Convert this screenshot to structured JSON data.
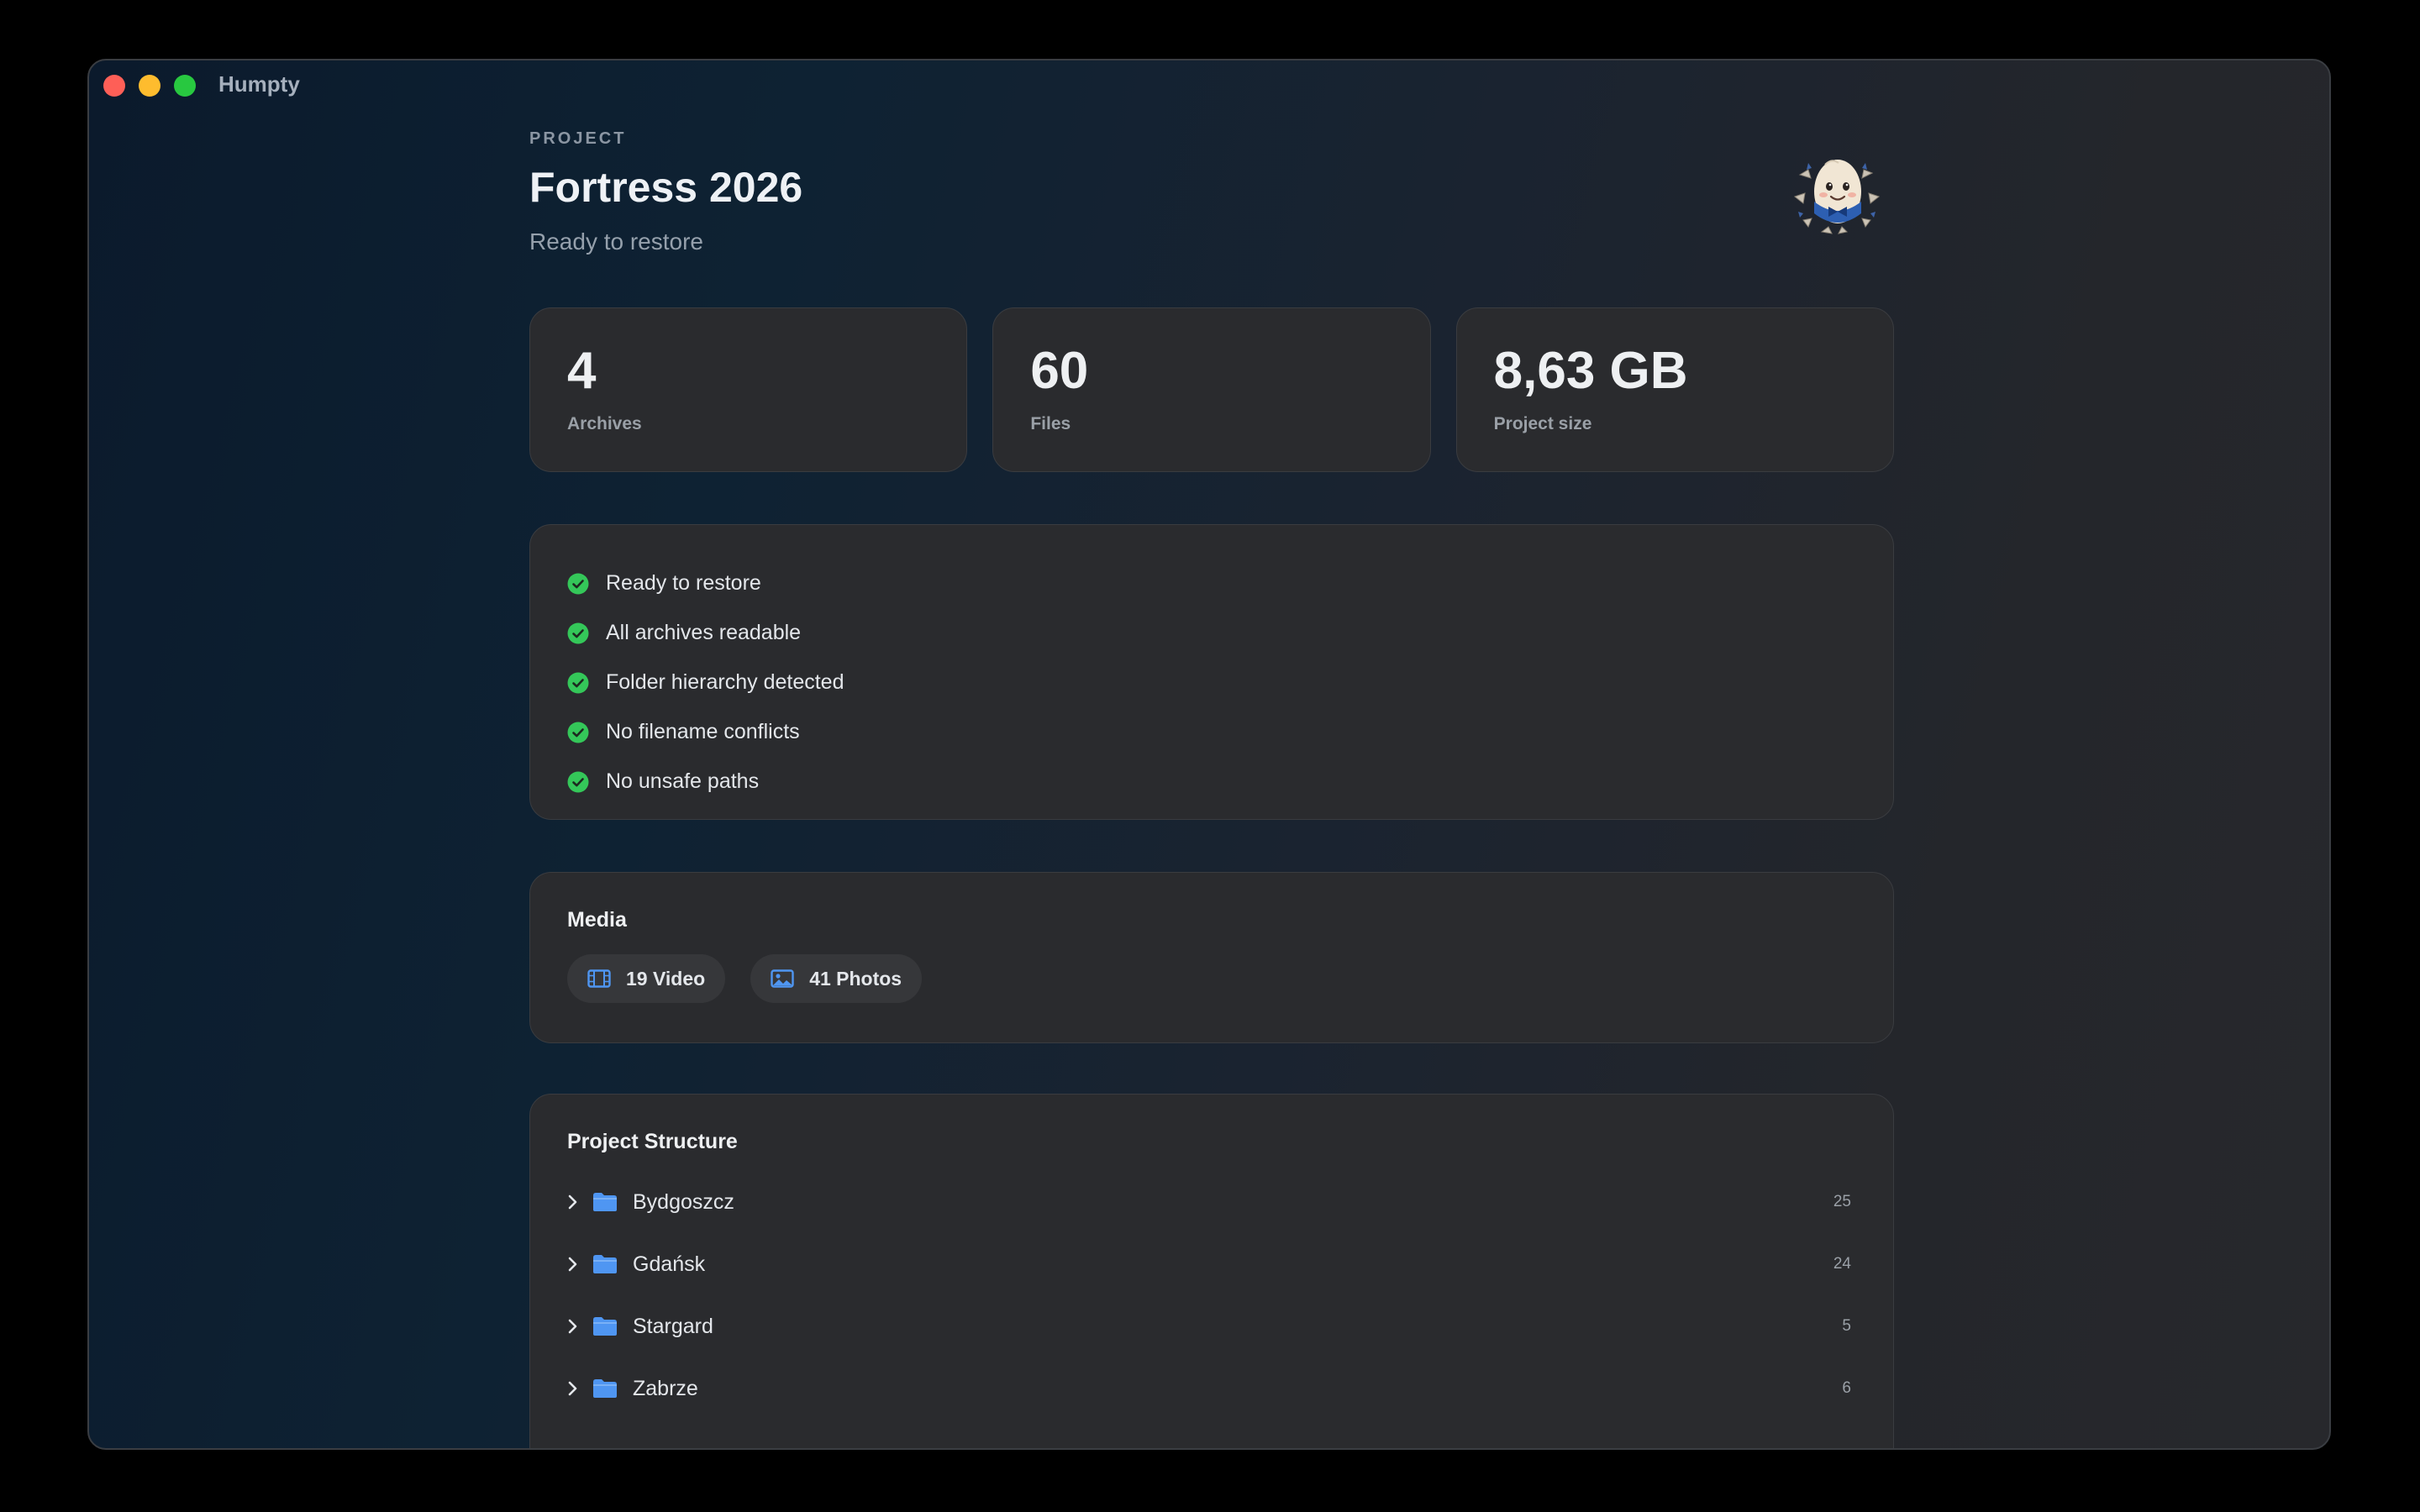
{
  "window": {
    "app_title": "Humpty"
  },
  "header": {
    "eyebrow": "PROJECT",
    "title": "Fortress 2026",
    "subtitle": "Ready to restore",
    "avatar_icon": "egg-mascot-icon"
  },
  "stats": [
    {
      "value": "4",
      "label": "Archives"
    },
    {
      "value": "60",
      "label": "Files"
    },
    {
      "value": "8,63 GB",
      "label": "Project size"
    }
  ],
  "checks": [
    {
      "text": "Ready to restore",
      "icon": "check-circle-icon"
    },
    {
      "text": "All archives readable",
      "icon": "check-circle-icon"
    },
    {
      "text": "Folder hierarchy detected",
      "icon": "check-circle-icon"
    },
    {
      "text": "No filename conflicts",
      "icon": "check-circle-icon"
    },
    {
      "text": "No unsafe paths",
      "icon": "check-circle-icon"
    }
  ],
  "media": {
    "heading": "Media",
    "chips": [
      {
        "label": "19 Video",
        "icon": "film-icon"
      },
      {
        "label": "41 Photos",
        "icon": "photo-icon"
      }
    ]
  },
  "structure": {
    "heading": "Project Structure",
    "folders": [
      {
        "name": "Bydgoszcz",
        "count": "25"
      },
      {
        "name": "Gdańsk",
        "count": "24"
      },
      {
        "name": "Stargard",
        "count": "5"
      },
      {
        "name": "Zabrze",
        "count": "6"
      }
    ]
  },
  "colors": {
    "accent_blue": "#4f96f2",
    "success_green": "#34c759",
    "card_background": "#2a2b2e"
  }
}
